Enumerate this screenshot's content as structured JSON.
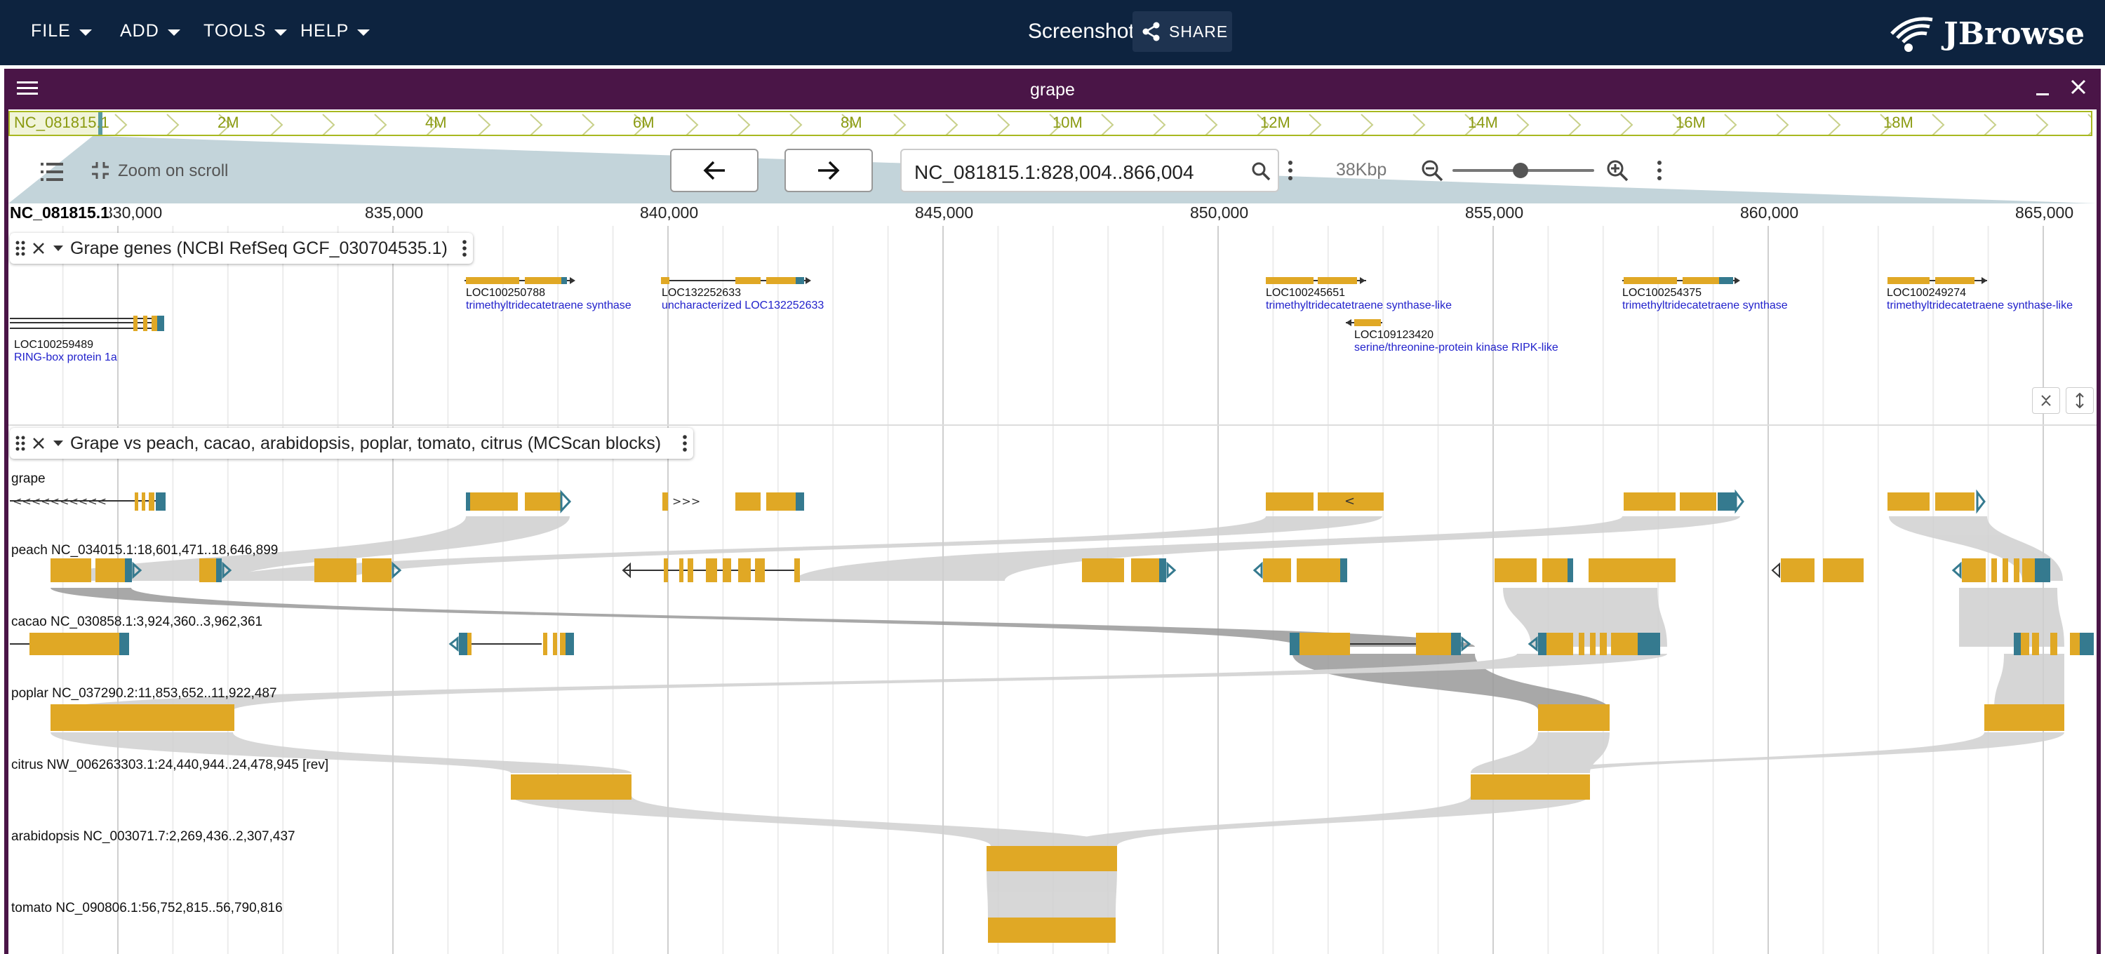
{
  "app": {
    "menus": [
      "FILE",
      "ADD",
      "TOOLS",
      "HELP"
    ],
    "screenshot_label": "Screenshot",
    "share_label": "SHARE",
    "logo_text": "JBrowse"
  },
  "view": {
    "title": "grape",
    "overview_labels": [
      "NC_081815.1",
      "2M",
      "4M",
      "6M",
      "8M",
      "10M",
      "12M",
      "14M",
      "16M",
      "18M"
    ],
    "zoom_on_scroll_label": "Zoom on scroll",
    "locus": "NC_081815.1:828,004..866,004",
    "span": "38Kbp",
    "ruler_refname": "NC_081815.1",
    "ruler_ticks": [
      "830,000",
      "835,000",
      "840,000",
      "845,000",
      "850,000",
      "855,000",
      "860,000",
      "865,000"
    ]
  },
  "tracks": {
    "genes": {
      "title": "Grape genes (NCBI RefSeq GCF_030704535.1)",
      "features": [
        {
          "name": "LOC100259489",
          "desc": "RING-box protein 1a"
        },
        {
          "name": "LOC100250788",
          "desc": "trimethyltridecatetraene synthase"
        },
        {
          "name": "LOC132252633",
          "desc": "uncharacterized LOC132252633"
        },
        {
          "name": "LOC100245651",
          "desc": "trimethyltridecatetraene synthase-like"
        },
        {
          "name": "LOC109123420",
          "desc": "serine/threonine-protein kinase RIPK-like"
        },
        {
          "name": "LOC100254375",
          "desc": "trimethyltridecatetraene synthase"
        },
        {
          "name": "LOC100249274",
          "desc": "trimethyltridecatetraene synthase-like"
        }
      ]
    },
    "synteny": {
      "title": "Grape vs peach, cacao, arabidopsis, poplar, tomato, citrus (MCScan blocks)",
      "rows": [
        "grape",
        "peach NC_034015.1:18,601,471..18,646,899",
        "cacao NC_030858.1:3,924,360..3,962,361",
        "poplar NC_037290.2:11,853,652..11,922,487",
        "citrus NW_006263303.1:24,440,944..24,478,945 [rev]",
        "arabidopsis NC_003071.7:2,269,436..2,307,437",
        "tomato NC_090806.1:56,752,815..56,790,816"
      ]
    }
  },
  "colors": {
    "appbar": "#0d233f",
    "view_header": "#4a1547",
    "exon": "#e0a825",
    "utr": "#357a8f",
    "overview": "#a8b820",
    "ribbon": "#d0d0d0",
    "ribbon_dark": "#9a9a9a"
  }
}
